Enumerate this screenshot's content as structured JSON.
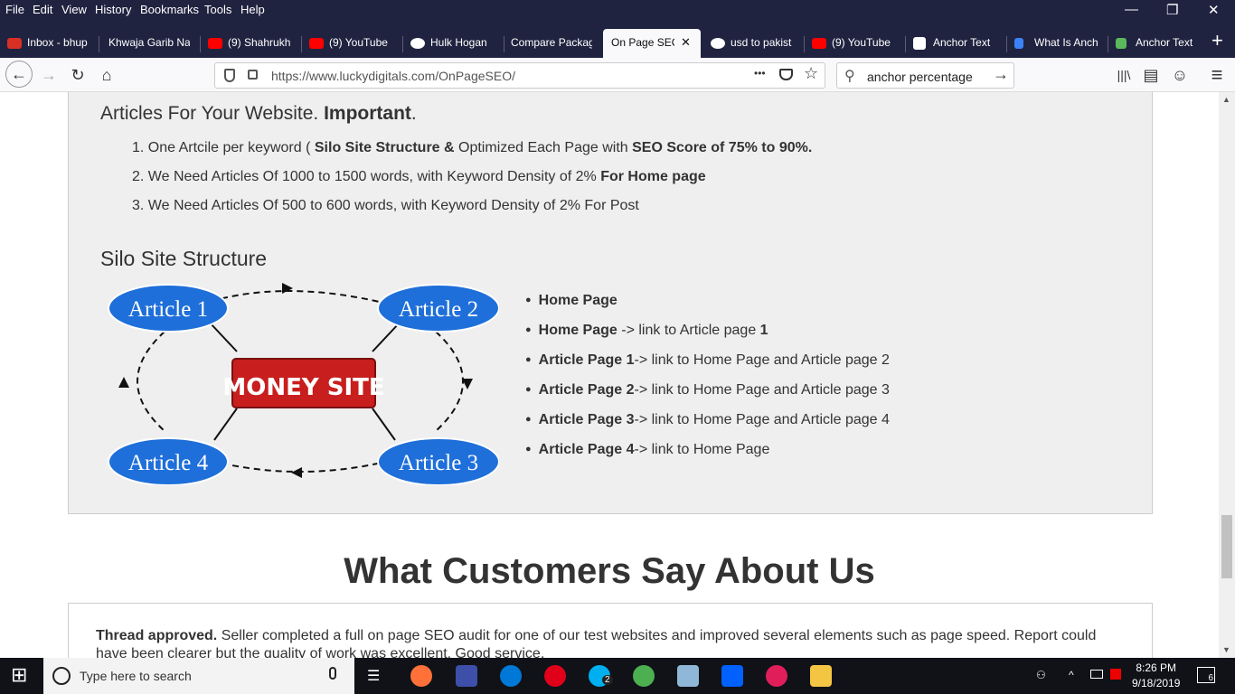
{
  "menu": {
    "file": "File",
    "edit": "Edit",
    "view": "View",
    "history": "History",
    "bookmarks": "Bookmarks",
    "tools": "Tools",
    "help": "Help"
  },
  "window_controls": {
    "minimize": "—",
    "restore": "❐",
    "close": "✕"
  },
  "tabs": [
    {
      "label": "Inbox - bhup",
      "color": "#d93025"
    },
    {
      "label": "Khwaja Garib Na",
      "color": "#202340"
    },
    {
      "label": "(9) Shahrukh",
      "color": "#ff0000"
    },
    {
      "label": "(9) YouTube",
      "color": "#ff0000"
    },
    {
      "label": "Hulk Hogan",
      "color": "#4285f4"
    },
    {
      "label": "Compare Packag",
      "color": "#202340"
    },
    {
      "label": "On Page SEO",
      "color": "#f9f9fb",
      "close": "✕"
    },
    {
      "label": "usd to pakist",
      "color": "#4285f4"
    },
    {
      "label": "(9) YouTube",
      "color": "#ff0000"
    },
    {
      "label": "Anchor Text",
      "color": "#ffffff"
    },
    {
      "label": "What Is Anch",
      "color": "#3b82f6"
    },
    {
      "label": "Anchor Text",
      "color": "#5cb85c"
    }
  ],
  "new_tab": "+",
  "nav": {
    "back": "←",
    "forward": "→",
    "reload": "↻",
    "home": "⌂",
    "url": "https://www.luckydigitals.com/OnPageSEO/",
    "page_actions": "•••",
    "search_value": "anchor percentage",
    "search_go": "→",
    "library": "|||\\",
    "sidebar": "▤",
    "account": "☺",
    "menu": "≡"
  },
  "articles": {
    "heading_pre": "Articles For Your Website. ",
    "heading_bold": "Important",
    "heading_post": ".",
    "items": [
      {
        "num": "1. ",
        "a": "One Artcile per keyword  ( ",
        "b": "Silo Site Structure & ",
        "c": "Optimized Each Page with ",
        "d": "SEO Score of 75% to 90%."
      },
      {
        "num": "2. ",
        "a": "We Need Articles Of 1000 to 1500 words, with Keyword Density of 2% ",
        "b": "For Home page"
      },
      {
        "num": "3. ",
        "a": "We Need Articles Of 500 to 600 words, with Keyword Density of 2% For Post"
      }
    ]
  },
  "silo": {
    "heading": "Silo Site Structure",
    "diagram": {
      "article1": "Article 1",
      "article2": "Article 2",
      "article3": "Article 3",
      "article4": "Article 4",
      "money_site": "MONEY SITE",
      "ellipse_color": "#1e6fd9",
      "money_color": "#c81e1e"
    },
    "list": [
      {
        "b": "Home Page",
        "t": ""
      },
      {
        "b": "Home Page",
        "t": " ->  link to Article page ",
        "b2": "1"
      },
      {
        "b": "Article Page 1",
        "t": "-> link to Home Page and Article page 2"
      },
      {
        "b": "Article Page 2",
        "t": "-> link to Home Page and Article page 3"
      },
      {
        "b": "Article Page 3",
        "t": "-> link to Home Page and Article page 4"
      },
      {
        "b": "Article Page 4",
        "t": "-> link to Home Page"
      }
    ]
  },
  "testimonials": {
    "heading": "What Customers Say About Us",
    "review_bold": "Thread approved.",
    "review_text": " Seller completed a full on page SEO audit for one of our test websites and improved several elements such as page speed. Report could have been clearer but the quality of work was excellent. Good service."
  },
  "taskbar": {
    "start": "⊞",
    "search_placeholder": "Type here to search",
    "mic": "🎤",
    "task_view": "☰",
    "time": "8:26 PM",
    "date": "9/18/2019",
    "notifications": "6",
    "skype_badge": "2"
  }
}
